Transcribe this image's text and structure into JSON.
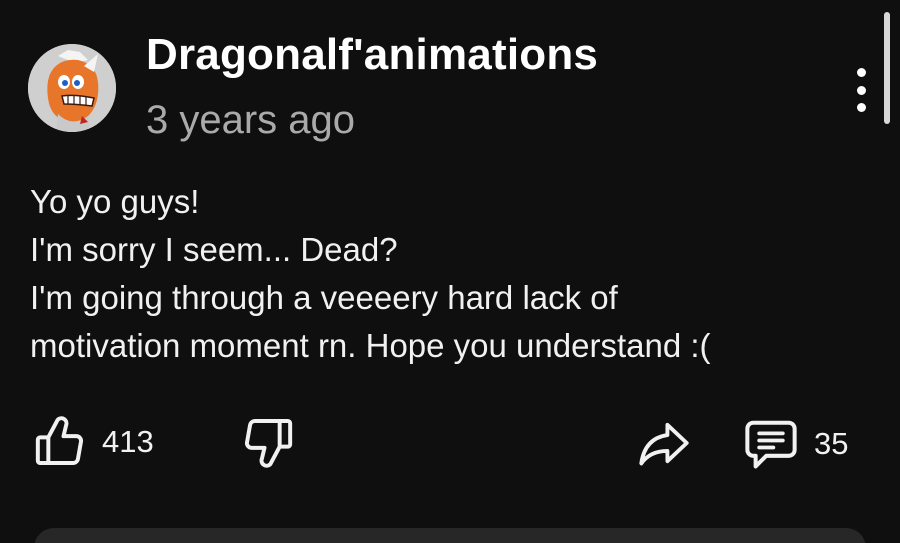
{
  "post": {
    "author": "Dragonalf'animations",
    "timestamp": "3 years ago",
    "avatar_icon": "orange-character-avatar",
    "body_lines": [
      "Yo yo guys!",
      "I'm sorry I seem... Dead?",
      "I'm going through a veeeery hard lack of",
      "motivation moment rn. Hope you understand :("
    ]
  },
  "actions": {
    "like_count": "413",
    "like_icon": "thumbs-up-icon",
    "dislike_icon": "thumbs-down-icon",
    "share_icon": "share-icon",
    "comment_icon": "comment-icon",
    "comment_count": "35"
  },
  "colors": {
    "background": "#0f0f0f",
    "text_primary": "#f1f1f1",
    "text_secondary": "#aaaaaa",
    "input_background": "#272727"
  }
}
